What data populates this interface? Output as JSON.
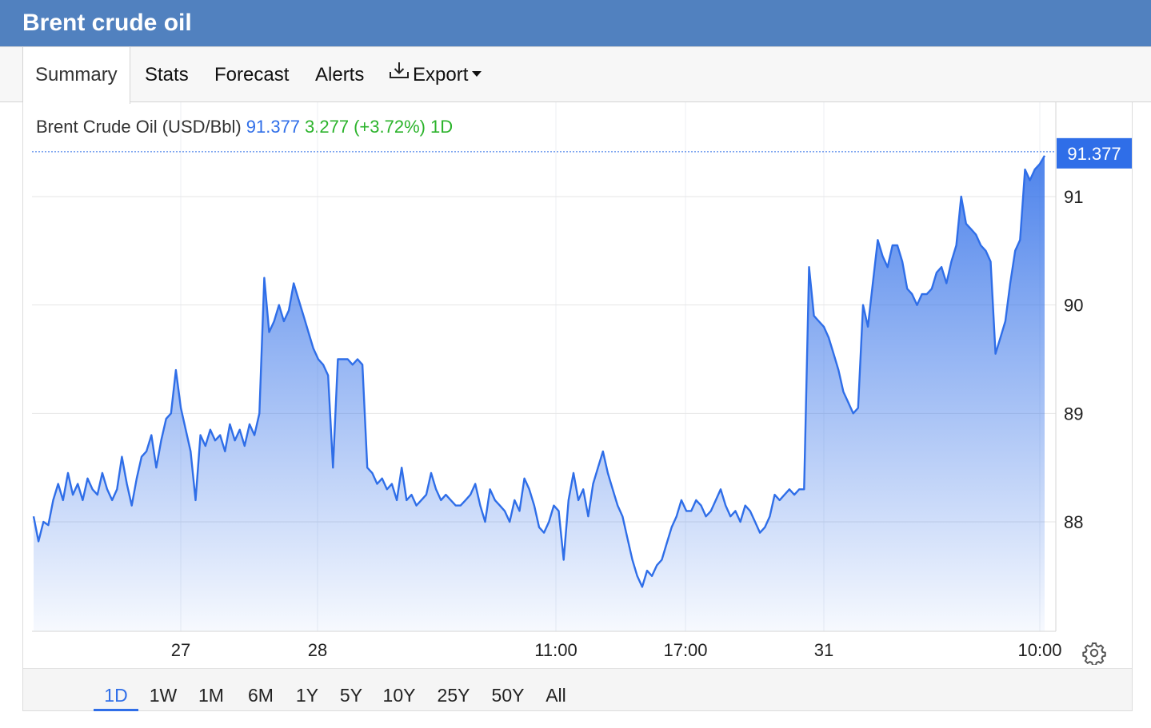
{
  "window": {
    "title": "Brent crude oil"
  },
  "tabs": [
    {
      "label": "Summary",
      "active": true
    },
    {
      "label": "Stats",
      "active": false
    },
    {
      "label": "Forecast",
      "active": false
    },
    {
      "label": "Alerts",
      "active": false
    },
    {
      "label": "Export",
      "active": false,
      "icon": "download-icon",
      "dropdown": true
    }
  ],
  "legend": {
    "name": "Brent Crude Oil (USD/Bbl)",
    "last": "91.377",
    "change": "3.277",
    "change_pct": "(+3.72%)",
    "period": "1D"
  },
  "price_tag": "91.377",
  "colors": {
    "title_bar": "#5181bf",
    "line": "#2f6ee8",
    "change_positive": "#2bb32b",
    "price_tag_bg": "#2f6ee8"
  },
  "periods": [
    {
      "label": "1D",
      "active": true
    },
    {
      "label": "1W",
      "active": false
    },
    {
      "label": "1M",
      "active": false
    },
    {
      "label": "6M",
      "active": false
    },
    {
      "label": "1Y",
      "active": false
    },
    {
      "label": "5Y",
      "active": false
    },
    {
      "label": "10Y",
      "active": false
    },
    {
      "label": "25Y",
      "active": false
    },
    {
      "label": "50Y",
      "active": false
    },
    {
      "label": "All",
      "active": false
    }
  ],
  "settings_icon": "gear-icon",
  "chart_data": {
    "type": "area",
    "title": "",
    "xlabel": "",
    "ylabel": "",
    "x_tick_labels": [
      "27",
      "28",
      "11:00",
      "17:00",
      "31",
      "10:00"
    ],
    "y_ticks": [
      88,
      89,
      90,
      91
    ],
    "ylim": [
      87.0,
      91.6
    ],
    "last_value": 91.377,
    "grid": true,
    "series": [
      {
        "values": [
          88.05,
          87.82,
          88.0,
          87.97,
          88.2,
          88.35,
          88.2,
          88.45,
          88.25,
          88.35,
          88.2,
          88.4,
          88.3,
          88.25,
          88.45,
          88.3,
          88.2,
          88.3,
          88.6,
          88.35,
          88.15,
          88.4,
          88.6,
          88.65,
          88.8,
          88.5,
          88.75,
          88.95,
          89.0,
          89.4,
          89.05,
          88.85,
          88.65,
          88.2,
          88.8,
          88.7,
          88.85,
          88.75,
          88.8,
          88.65,
          88.9,
          88.75,
          88.85,
          88.7,
          88.9,
          88.8,
          89.0,
          90.25,
          89.75,
          89.85,
          90.0,
          89.85,
          89.95,
          90.2,
          90.05,
          89.9,
          89.75,
          89.6,
          89.5,
          89.45,
          89.35,
          88.5,
          89.5,
          89.5,
          89.5,
          89.45,
          89.5,
          89.45,
          88.5,
          88.45,
          88.35,
          88.4,
          88.3,
          88.35,
          88.2,
          88.5,
          88.2,
          88.25,
          88.15,
          88.2,
          88.25,
          88.45,
          88.3,
          88.2,
          88.25,
          88.2,
          88.15,
          88.15,
          88.2,
          88.25,
          88.35,
          88.15,
          88.0,
          88.3,
          88.2,
          88.15,
          88.1,
          88.0,
          88.2,
          88.1,
          88.4,
          88.3,
          88.15,
          87.95,
          87.9,
          88.0,
          88.15,
          88.1,
          87.65,
          88.2,
          88.45,
          88.2,
          88.3,
          88.05,
          88.35,
          88.5,
          88.65,
          88.45,
          88.3,
          88.15,
          88.05,
          87.85,
          87.65,
          87.5,
          87.4,
          87.55,
          87.5,
          87.6,
          87.65,
          87.8,
          87.95,
          88.05,
          88.2,
          88.1,
          88.1,
          88.2,
          88.15,
          88.05,
          88.1,
          88.2,
          88.3,
          88.15,
          88.05,
          88.1,
          88.0,
          88.15,
          88.1,
          88.0,
          87.9,
          87.95,
          88.05,
          88.25,
          88.2,
          88.25,
          88.3,
          88.25,
          88.3,
          88.3,
          90.35,
          89.9,
          89.85,
          89.8,
          89.7,
          89.55,
          89.4,
          89.2,
          89.1,
          89.0,
          89.05,
          90.0,
          89.8,
          90.2,
          90.6,
          90.45,
          90.35,
          90.55,
          90.55,
          90.4,
          90.15,
          90.1,
          90.0,
          90.1,
          90.1,
          90.15,
          90.3,
          90.35,
          90.2,
          90.4,
          90.55,
          91.0,
          90.75,
          90.7,
          90.65,
          90.55,
          90.5,
          90.4,
          89.55,
          89.7,
          89.85,
          90.2,
          90.5,
          90.6,
          91.25,
          91.15,
          91.25,
          91.3,
          91.377
        ]
      }
    ]
  }
}
